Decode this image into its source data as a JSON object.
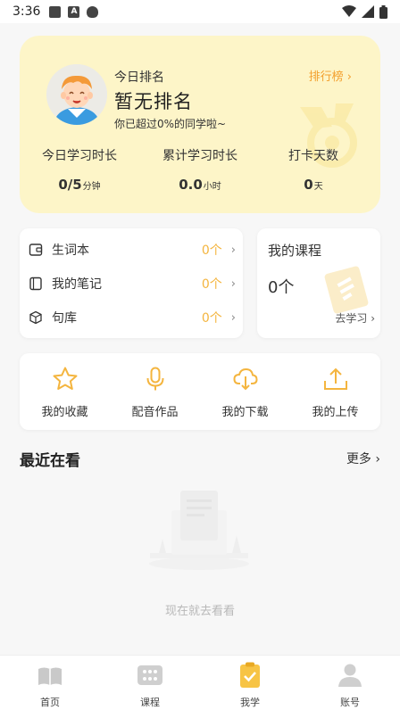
{
  "status_bar": {
    "time": "3:36"
  },
  "rank_card": {
    "label": "今日排名",
    "title": "暂无排名",
    "subtitle": "你已超过0%的同学啦~",
    "ranking_link": "排行榜 ›",
    "stats": [
      {
        "label": "今日学习时长",
        "value": "0/5",
        "unit": "分钟"
      },
      {
        "label": "累计学习时长",
        "value": "0.0",
        "unit": "小时"
      },
      {
        "label": "打卡天数",
        "value": "0",
        "unit": "天"
      }
    ]
  },
  "word_list": [
    {
      "label": "生词本",
      "count": "0个",
      "icon": "wallet-icon"
    },
    {
      "label": "我的笔记",
      "count": "0个",
      "icon": "notebook-icon"
    },
    {
      "label": "句库",
      "count": "0个",
      "icon": "cube-icon"
    }
  ],
  "course_card": {
    "title": "我的课程",
    "count": "0个",
    "link": "去学习 ›"
  },
  "actions": [
    {
      "label": "我的收藏",
      "icon": "star-icon"
    },
    {
      "label": "配音作品",
      "icon": "microphone-icon"
    },
    {
      "label": "我的下载",
      "icon": "cloud-download-icon"
    },
    {
      "label": "我的上传",
      "icon": "upload-icon"
    }
  ],
  "recent": {
    "title": "最近在看",
    "more": "更多 ›",
    "empty_text": "现在就去看看"
  },
  "bottom_nav": [
    {
      "label": "首页",
      "icon": "book-icon",
      "active": false
    },
    {
      "label": "课程",
      "icon": "grid-icon",
      "active": false
    },
    {
      "label": "我学",
      "icon": "clipboard-check-icon",
      "active": true
    },
    {
      "label": "账号",
      "icon": "user-icon",
      "active": false
    }
  ],
  "colors": {
    "accent": "#f4b53f",
    "card_yellow": "#fdf5c8",
    "link_orange": "#f3a02e"
  }
}
